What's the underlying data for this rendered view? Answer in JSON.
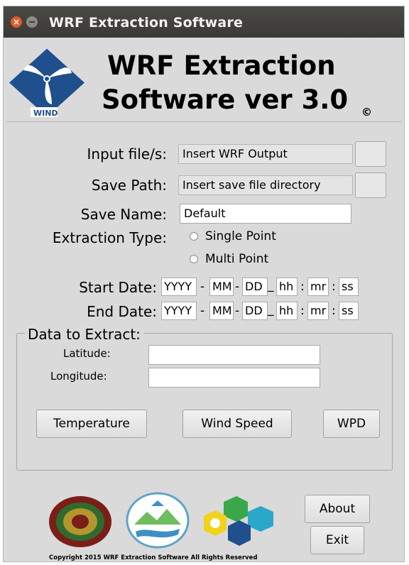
{
  "window": {
    "title": "WRF Extraction Software",
    "header_line1": "WRF Extraction",
    "header_line2": "Software ver 3.0",
    "copyright_symbol": "©",
    "logo_text": "WIND"
  },
  "form": {
    "input_files": {
      "label": "Input file/s:",
      "value": "Insert WRF Output"
    },
    "save_path": {
      "label": "Save Path:",
      "value": "Insert save file directory"
    },
    "save_name": {
      "label": "Save Name:",
      "value": "Default"
    },
    "extraction_type": {
      "label": "Extraction Type:",
      "options": [
        "Single Point",
        "Multi Point"
      ],
      "selected": null
    },
    "start_date": {
      "label": "Start Date:",
      "year": "YYYY",
      "month": "MM",
      "day": "DD",
      "hour": "hh",
      "minute": "mr",
      "second": "ss"
    },
    "end_date": {
      "label": "End Date:",
      "year": "YYYY",
      "month": "MM",
      "day": "DD",
      "hour": "hh",
      "minute": "mr",
      "second": "ss"
    },
    "separators": {
      "dash": "-",
      "underscore": "_",
      "colon": ":"
    }
  },
  "extract": {
    "title": "Data to Extract:",
    "latitude": {
      "label": "Latitude:",
      "value": ""
    },
    "longitude": {
      "label": "Longitude:",
      "value": ""
    },
    "buttons": {
      "temperature": "Temperature",
      "wind_speed": "Wind Speed",
      "wpd": "WPD"
    }
  },
  "footer": {
    "about": "About",
    "exit": "Exit",
    "copyright": "Copyright 2015 WRF Extraction Software All Rights Reserved"
  },
  "colors": {
    "window_bg": "#dadada",
    "titlebar": "#3c3b37",
    "close_button": "#e2592a",
    "wind_logo": "#1f4f8c"
  },
  "icons": [
    "close-icon",
    "minimize-icon",
    "wind-logo",
    "up-seal-logo",
    "watershed-logo",
    "energy-logo"
  ]
}
